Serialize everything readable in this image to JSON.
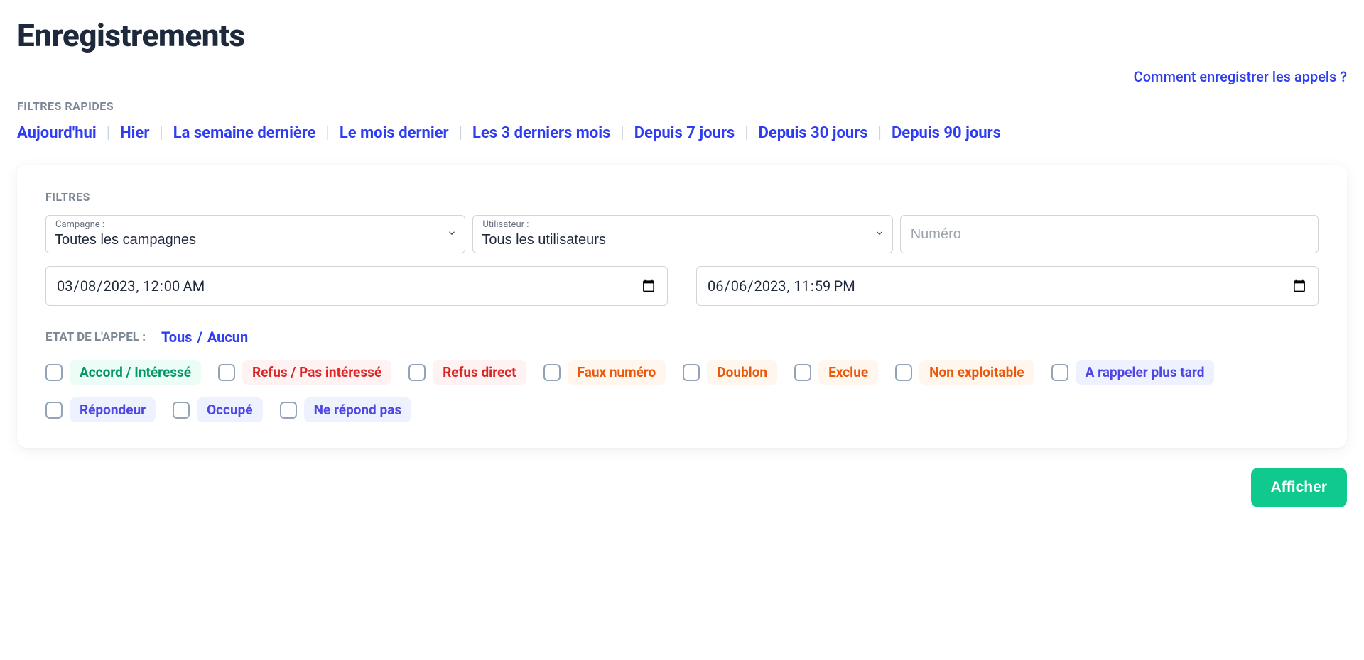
{
  "page": {
    "title": "Enregistrements",
    "help_link": "Comment enregistrer les appels ?"
  },
  "quick_filters": {
    "label": "FILTRES RAPIDES",
    "items": [
      "Aujourd'hui",
      "Hier",
      "La semaine dernière",
      "Le mois dernier",
      "Les 3 derniers mois",
      "Depuis 7 jours",
      "Depuis 30 jours",
      "Depuis 90 jours"
    ]
  },
  "filters": {
    "label": "FILTRES",
    "campagne": {
      "label": "Campagne :",
      "selected": "Toutes les campagnes"
    },
    "utilisateur": {
      "label": "Utilisateur :",
      "selected": "Tous les utilisateurs"
    },
    "numero": {
      "placeholder": "Numéro",
      "value": ""
    },
    "date_from": "2023-03-08T00:00",
    "date_to": "2023-06-06T23:59"
  },
  "call_state": {
    "label": "ETAT DE L'APPEL :",
    "all": "Tous",
    "none": "Aucun",
    "tags": [
      {
        "text": "Accord / Intéressé",
        "tone": "green"
      },
      {
        "text": "Refus / Pas intéressé",
        "tone": "red"
      },
      {
        "text": "Refus direct",
        "tone": "red"
      },
      {
        "text": "Faux numéro",
        "tone": "orange"
      },
      {
        "text": "Doublon",
        "tone": "orange"
      },
      {
        "text": "Exclue",
        "tone": "orange"
      },
      {
        "text": "Non exploitable",
        "tone": "orange"
      },
      {
        "text": "A rappeler plus tard",
        "tone": "blue"
      },
      {
        "text": "Répondeur",
        "tone": "blue"
      },
      {
        "text": "Occupé",
        "tone": "blue"
      },
      {
        "text": "Ne répond pas",
        "tone": "blue"
      }
    ]
  },
  "actions": {
    "submit": "Afficher"
  }
}
